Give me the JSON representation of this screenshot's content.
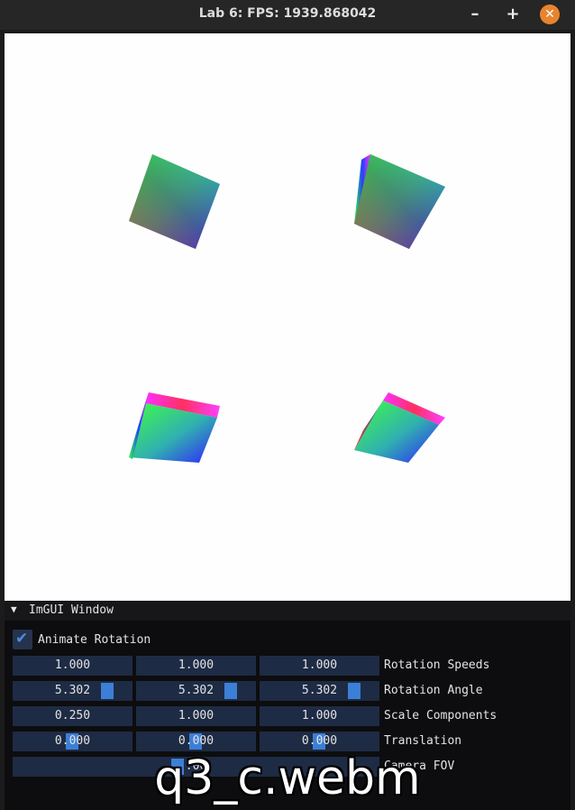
{
  "window": {
    "title": "Lab 6: FPS: 1939.868042",
    "minimize_glyph": "–",
    "maximize_glyph": "+",
    "close_glyph": "✕"
  },
  "imgui": {
    "window_title": "ImGUI Window",
    "collapse_glyph": "▼",
    "animate_checkbox": {
      "label": "Animate Rotation",
      "checked": true,
      "glyph": "✔"
    },
    "rows": [
      {
        "label": "Rotation Speeds",
        "values": [
          "1.000",
          "1.000",
          "1.000"
        ]
      },
      {
        "label": "Rotation Angle",
        "values": [
          "5.302",
          "5.302",
          "5.302"
        ]
      },
      {
        "label": "Scale Components",
        "values": [
          "0.250",
          "1.000",
          "1.000"
        ]
      },
      {
        "label": "Translation",
        "values": [
          "0.000",
          "0.000",
          "0.000"
        ]
      },
      {
        "label": "Camera FOV",
        "values": [
          "  .00"
        ]
      }
    ]
  },
  "overlay_caption": "q3_c.webm",
  "colors": {
    "accent": "#3c7fd6",
    "panel": "#0d0d0f",
    "field": "#1e2b44",
    "titlebar": "#262626",
    "close": "#e8842e"
  }
}
